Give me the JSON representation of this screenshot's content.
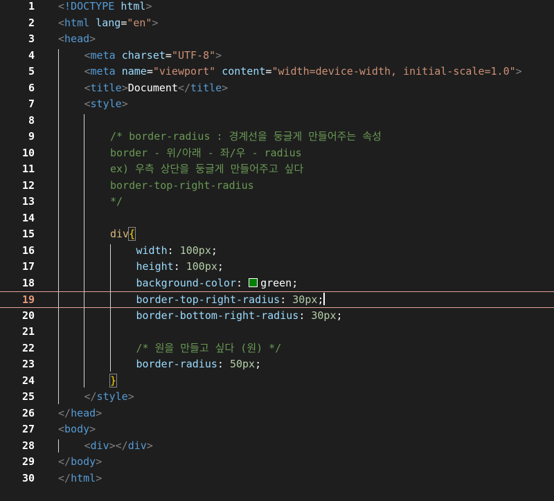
{
  "editor": {
    "active_line": 19,
    "accent_colors": {
      "tag": "#569cd6",
      "attribute": "#9cdcfe",
      "string": "#ce9178",
      "comment": "#6a9955",
      "selector": "#d7ba7d",
      "number": "#b5cea8",
      "brace": "#ffd700",
      "active_line_number": "#e99a7b",
      "swatch_green": "#008000"
    },
    "lines": [
      {
        "n": "1",
        "indent": 0,
        "tokens": [
          [
            "punc",
            "<"
          ],
          [
            "doc",
            "!DOCTYPE"
          ],
          [
            "text",
            " "
          ],
          [
            "attr",
            "html"
          ],
          [
            "punc",
            ">"
          ]
        ]
      },
      {
        "n": "2",
        "indent": 0,
        "tokens": [
          [
            "punc",
            "<"
          ],
          [
            "tag",
            "html"
          ],
          [
            "text",
            " "
          ],
          [
            "attr",
            "lang"
          ],
          [
            "text",
            "="
          ],
          [
            "str",
            "\"en\""
          ],
          [
            "punc",
            ">"
          ]
        ]
      },
      {
        "n": "3",
        "indent": 0,
        "tokens": [
          [
            "punc",
            "<"
          ],
          [
            "tag",
            "head"
          ],
          [
            "punc",
            ">"
          ]
        ]
      },
      {
        "n": "4",
        "indent": 1,
        "tokens": [
          [
            "punc",
            "<"
          ],
          [
            "tag",
            "meta"
          ],
          [
            "text",
            " "
          ],
          [
            "attr",
            "charset"
          ],
          [
            "text",
            "="
          ],
          [
            "str",
            "\"UTF-8\""
          ],
          [
            "punc",
            ">"
          ]
        ]
      },
      {
        "n": "5",
        "indent": 1,
        "tokens": [
          [
            "punc",
            "<"
          ],
          [
            "tag",
            "meta"
          ],
          [
            "text",
            " "
          ],
          [
            "attr",
            "name"
          ],
          [
            "text",
            "="
          ],
          [
            "str",
            "\"viewport\""
          ],
          [
            "text",
            " "
          ],
          [
            "attr",
            "content"
          ],
          [
            "text",
            "="
          ],
          [
            "str",
            "\"width=device-width, initial-scale=1.0\""
          ],
          [
            "punc",
            ">"
          ]
        ]
      },
      {
        "n": "6",
        "indent": 1,
        "tokens": [
          [
            "punc",
            "<"
          ],
          [
            "tag",
            "title"
          ],
          [
            "punc",
            ">"
          ],
          [
            "text",
            "Document"
          ],
          [
            "punc",
            "</"
          ],
          [
            "tag",
            "title"
          ],
          [
            "punc",
            ">"
          ]
        ]
      },
      {
        "n": "7",
        "indent": 1,
        "tokens": [
          [
            "punc",
            "<"
          ],
          [
            "tag",
            "style"
          ],
          [
            "punc",
            ">"
          ]
        ]
      },
      {
        "n": "8",
        "indent": 0,
        "tokens": []
      },
      {
        "n": "9",
        "indent": 2,
        "tokens": [
          [
            "cmt",
            "/* border-radius : 경계선을 둥글게 만들어주는 속성"
          ]
        ]
      },
      {
        "n": "10",
        "indent": 2,
        "tokens": [
          [
            "cmt",
            "border - 위/아래 - 좌/우 - radius"
          ]
        ]
      },
      {
        "n": "11",
        "indent": 2,
        "tokens": [
          [
            "cmt",
            "ex) 우측 상단을 둥글게 만들어주고 싶다"
          ]
        ]
      },
      {
        "n": "12",
        "indent": 2,
        "tokens": [
          [
            "cmt",
            "border-top-right-radius"
          ]
        ]
      },
      {
        "n": "13",
        "indent": 2,
        "tokens": [
          [
            "cmt",
            "*/"
          ]
        ]
      },
      {
        "n": "14",
        "indent": 0,
        "tokens": []
      },
      {
        "n": "15",
        "indent": 2,
        "tokens": [
          [
            "sel",
            "div"
          ],
          [
            "bracebox",
            "{"
          ]
        ]
      },
      {
        "n": "16",
        "indent": 3,
        "tokens": [
          [
            "prop",
            "width"
          ],
          [
            "text",
            ": "
          ],
          [
            "num",
            "100px"
          ],
          [
            "text",
            ";"
          ]
        ]
      },
      {
        "n": "17",
        "indent": 3,
        "tokens": [
          [
            "prop",
            "height"
          ],
          [
            "text",
            ": "
          ],
          [
            "num",
            "100px"
          ],
          [
            "text",
            ";"
          ]
        ]
      },
      {
        "n": "18",
        "indent": 3,
        "tokens": [
          [
            "prop",
            "background-color"
          ],
          [
            "text",
            ": "
          ],
          [
            "swatch",
            ""
          ],
          [
            "text",
            "green;"
          ]
        ]
      },
      {
        "n": "19",
        "indent": 3,
        "tokens": [
          [
            "prop",
            "border-top-right-radius"
          ],
          [
            "text",
            ": "
          ],
          [
            "num",
            "30px"
          ],
          [
            "text",
            ";"
          ],
          [
            "cursor",
            ""
          ]
        ]
      },
      {
        "n": "20",
        "indent": 3,
        "tokens": [
          [
            "prop",
            "border-bottom-right-radius"
          ],
          [
            "text",
            ": "
          ],
          [
            "num",
            "30px"
          ],
          [
            "text",
            ";"
          ]
        ]
      },
      {
        "n": "21",
        "indent": 0,
        "tokens": []
      },
      {
        "n": "22",
        "indent": 3,
        "tokens": [
          [
            "cmt",
            "/* 원을 만들고 싶다 (원) */"
          ]
        ]
      },
      {
        "n": "23",
        "indent": 3,
        "tokens": [
          [
            "prop",
            "border-radius"
          ],
          [
            "text",
            ": "
          ],
          [
            "num",
            "50px"
          ],
          [
            "text",
            ";"
          ]
        ]
      },
      {
        "n": "24",
        "indent": 2,
        "tokens": [
          [
            "bracebox",
            "}"
          ]
        ]
      },
      {
        "n": "25",
        "indent": 1,
        "tokens": [
          [
            "punc",
            "</"
          ],
          [
            "tag",
            "style"
          ],
          [
            "punc",
            ">"
          ]
        ]
      },
      {
        "n": "26",
        "indent": 0,
        "tokens": [
          [
            "punc",
            "</"
          ],
          [
            "tag",
            "head"
          ],
          [
            "punc",
            ">"
          ]
        ]
      },
      {
        "n": "27",
        "indent": 0,
        "tokens": [
          [
            "punc",
            "<"
          ],
          [
            "tag",
            "body"
          ],
          [
            "punc",
            ">"
          ]
        ]
      },
      {
        "n": "28",
        "indent": 1,
        "tokens": [
          [
            "punc",
            "<"
          ],
          [
            "tag",
            "div"
          ],
          [
            "punc",
            "></"
          ],
          [
            "tag",
            "div"
          ],
          [
            "punc",
            ">"
          ]
        ]
      },
      {
        "n": "29",
        "indent": 0,
        "tokens": [
          [
            "punc",
            "</"
          ],
          [
            "tag",
            "body"
          ],
          [
            "punc",
            ">"
          ]
        ]
      },
      {
        "n": "30",
        "indent": 0,
        "tokens": [
          [
            "punc",
            "</"
          ],
          [
            "tag",
            "html"
          ],
          [
            "punc",
            ">"
          ]
        ]
      }
    ]
  }
}
